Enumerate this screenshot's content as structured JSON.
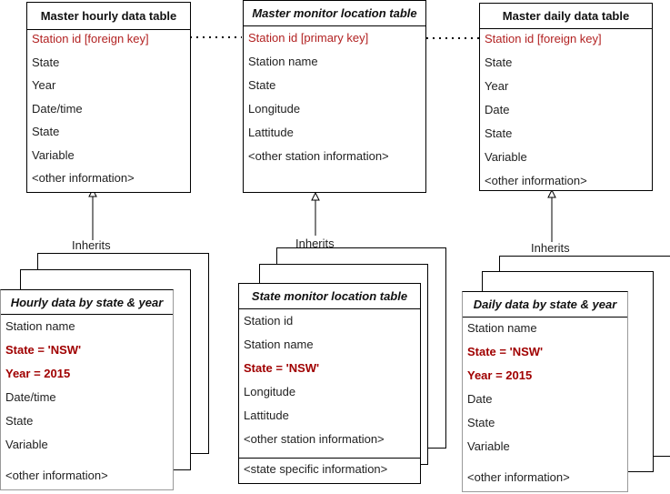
{
  "tables": {
    "master_hourly": {
      "title": "Master hourly data table",
      "italic": false,
      "rows": [
        {
          "text": "Station id [foreign key]",
          "style": "key"
        },
        {
          "text": "State"
        },
        {
          "text": "Year"
        },
        {
          "text": "Date/time"
        },
        {
          "text": "State"
        },
        {
          "text": "Variable"
        },
        {
          "text": "<other information>"
        }
      ]
    },
    "master_monitor": {
      "title": "Master monitor location table",
      "italic": true,
      "rows": [
        {
          "text": "Station id [primary key]",
          "style": "key"
        },
        {
          "text": "Station name"
        },
        {
          "text": "State"
        },
        {
          "text": "Longitude"
        },
        {
          "text": "Lattitude"
        },
        {
          "text": "<other station information>"
        }
      ]
    },
    "master_daily": {
      "title": "Master daily data table",
      "italic": false,
      "rows": [
        {
          "text": "Station id [foreign key]",
          "style": "key"
        },
        {
          "text": "State"
        },
        {
          "text": "Year"
        },
        {
          "text": "Date"
        },
        {
          "text": "State"
        },
        {
          "text": "Variable"
        },
        {
          "text": "<other information>"
        }
      ]
    },
    "hourly_state_year": {
      "title": "Hourly data by state & year",
      "italic": true,
      "rows": [
        {
          "text": "Station name"
        },
        {
          "text": "State = 'NSW'",
          "style": "bold"
        },
        {
          "text": "Year = 2015",
          "style": "bold"
        },
        {
          "text": "Date/time"
        },
        {
          "text": "State"
        },
        {
          "text": "Variable"
        },
        {
          "text": "<other information>"
        }
      ]
    },
    "state_monitor": {
      "title": "State monitor location table",
      "italic": true,
      "rows": [
        {
          "text": "Station id"
        },
        {
          "text": "Station name"
        },
        {
          "text": "State = 'NSW'",
          "style": "bold"
        },
        {
          "text": "Longitude"
        },
        {
          "text": "Lattitude"
        },
        {
          "text": "<other station information>"
        }
      ],
      "extra": "<state specific information>"
    },
    "daily_state_year": {
      "title": "Daily data by state & year",
      "italic": true,
      "rows": [
        {
          "text": "Station name"
        },
        {
          "text": "State = 'NSW'",
          "style": "bold"
        },
        {
          "text": "Year = 2015",
          "style": "bold"
        },
        {
          "text": "Date"
        },
        {
          "text": "State"
        },
        {
          "text": "Variable"
        },
        {
          "text": "<other information>"
        }
      ]
    }
  },
  "relations": {
    "inherits_label": "Inherits"
  },
  "colors": {
    "key": "#b22222",
    "filter": "#a00000",
    "line": "#000000"
  }
}
